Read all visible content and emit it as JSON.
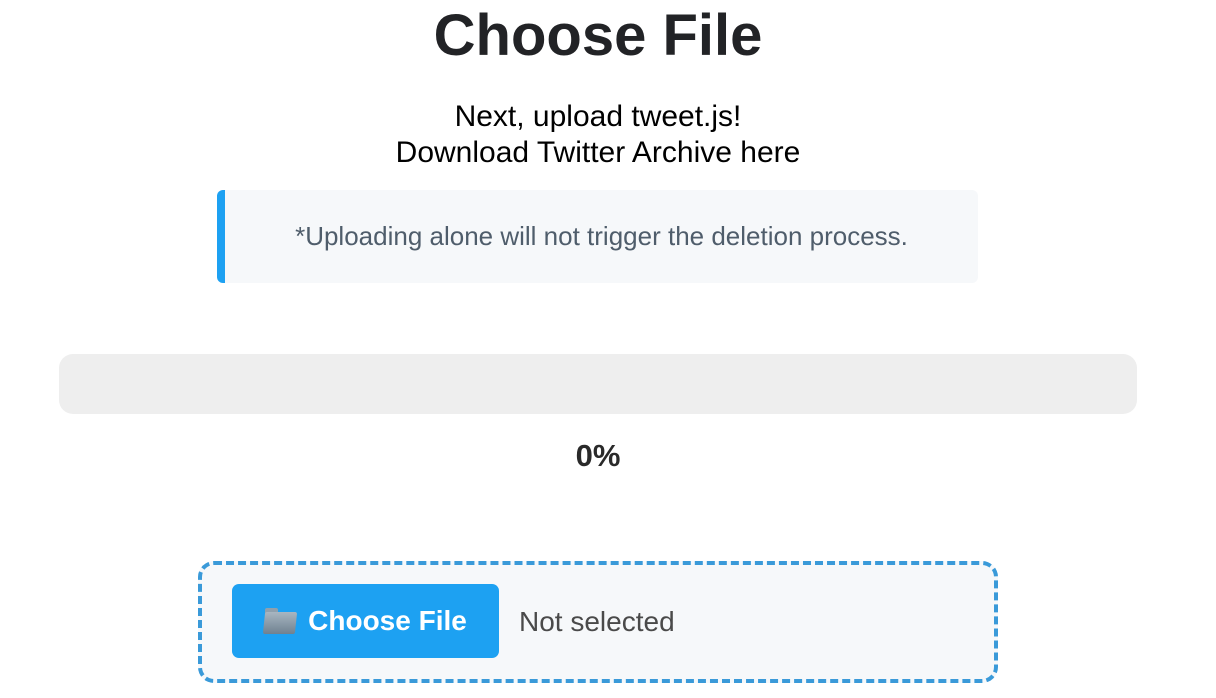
{
  "page": {
    "title": "Choose File",
    "subtitle_line1": "Next, upload tweet.js!",
    "subtitle_link": "Download Twitter Archive here",
    "notice": "*Uploading alone will not trigger the deletion process."
  },
  "progress": {
    "value": 0,
    "label": "0%"
  },
  "upload": {
    "button_label": "Choose File",
    "button_icon": "folder-icon",
    "file_status": "Not selected"
  },
  "colors": {
    "accent": "#1da1f2",
    "dashed_border": "#3a9ad9",
    "track": "#eeeeee",
    "panel": "#f6f8fa"
  }
}
